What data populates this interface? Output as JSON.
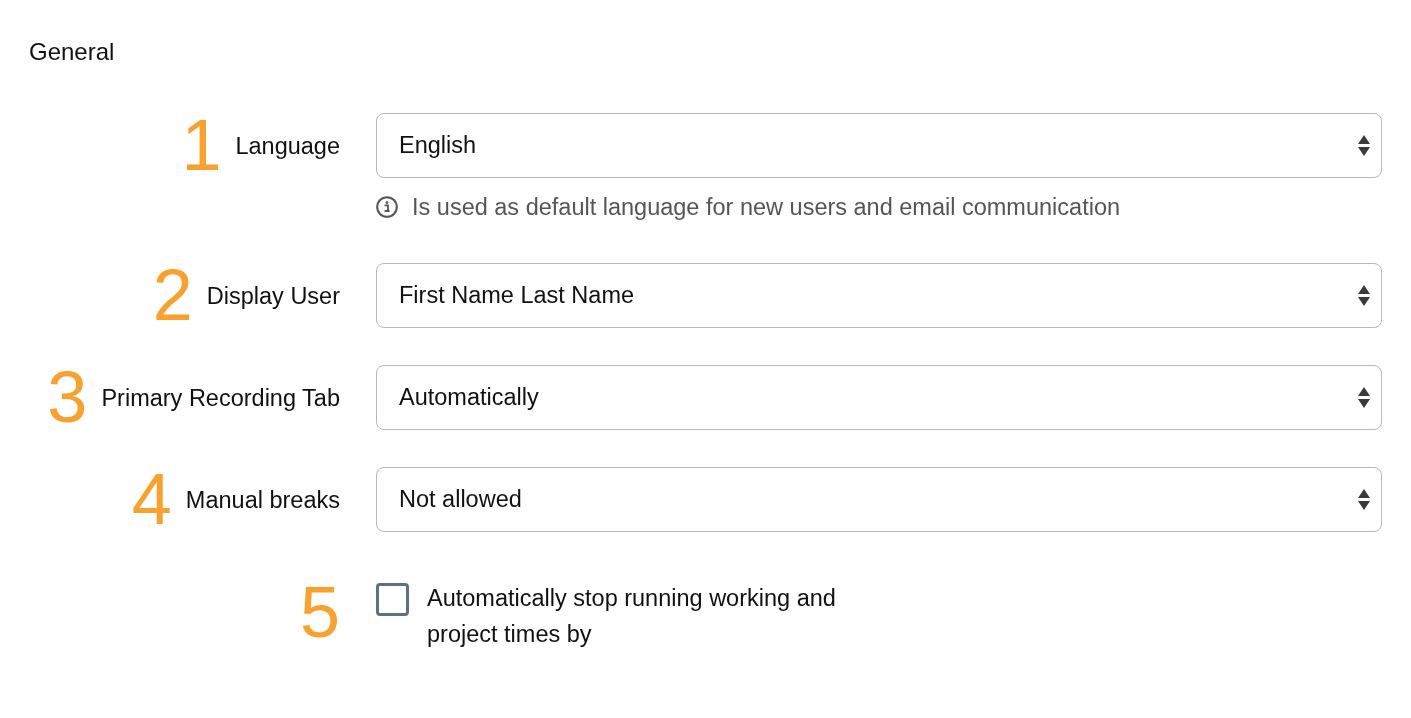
{
  "section_title": "General",
  "settings": [
    {
      "marker": "1",
      "label": "Language",
      "value": "English",
      "hint": "Is used as default language for new users and email communication"
    },
    {
      "marker": "2",
      "label": "Display User",
      "value": "First Name Last Name"
    },
    {
      "marker": "3",
      "label": "Primary Recording Tab",
      "value": "Automatically"
    },
    {
      "marker": "4",
      "label": "Manual breaks",
      "value": "Not allowed"
    }
  ],
  "auto_stop": {
    "marker": "5",
    "label": "Automatically stop running working and project times by",
    "checked": false
  }
}
